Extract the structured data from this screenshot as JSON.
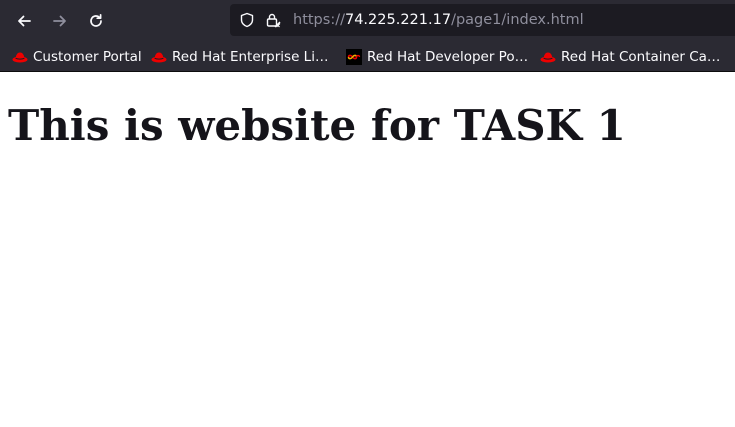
{
  "browser": {
    "nav": {
      "back_icon": "arrow-left-icon",
      "forward_icon": "arrow-right-icon",
      "reload_icon": "reload-icon"
    },
    "urlbar": {
      "shield_icon": "tracking-protection-shield-icon",
      "lock_icon": "insecure-lock-icon",
      "scheme": "https://",
      "host": "74.225.221.17",
      "path": "/page1/index.html"
    },
    "bookmarks": [
      {
        "label": "Customer Portal",
        "icon": "redhat-fedora-icon"
      },
      {
        "label": "Red Hat Enterprise Lin…",
        "icon": "redhat-fedora-icon"
      },
      {
        "label": "Red Hat Developer Por…",
        "icon": "redhat-developer-icon"
      },
      {
        "label": "Red Hat Container Cat…",
        "icon": "redhat-fedora-icon"
      }
    ]
  },
  "page": {
    "heading": "This is website for TASK 1"
  },
  "colors": {
    "toolbar_bg": "#2b2a33",
    "urlbar_bg": "#1c1b22",
    "redhat_red": "#ee0000",
    "page_bg": "#ffffff",
    "heading_text": "#15141a"
  }
}
